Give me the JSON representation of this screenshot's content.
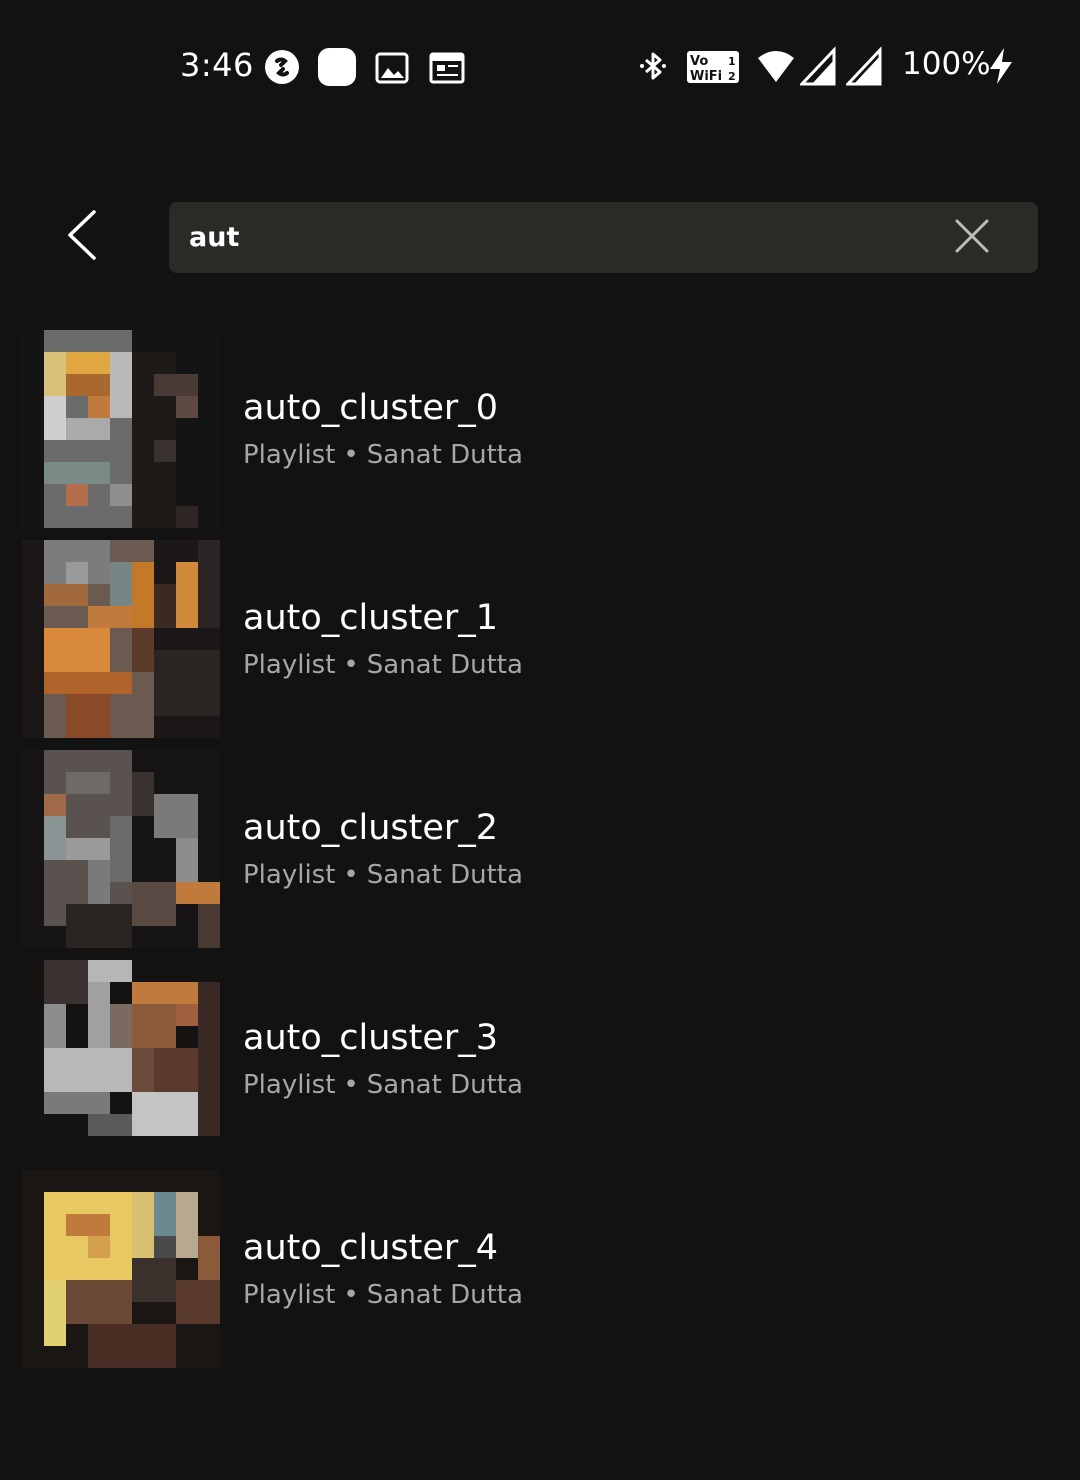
{
  "status_bar": {
    "time": "3:46",
    "battery": "100%",
    "icons_left": [
      "shazam-icon",
      "app-notification-icon",
      "image-icon",
      "calendar-icon"
    ],
    "icons_right": [
      "bluetooth-icon",
      "vowifi-icon",
      "wifi-icon",
      "signal-icon",
      "signal-icon",
      "charging-icon"
    ],
    "vowifi_line1": "Vo",
    "vowifi_line2": "WiFi",
    "vowifi_sim1": "1",
    "vowifi_sim2": "2"
  },
  "search": {
    "query": "aut",
    "back_icon": "chevron-left-icon",
    "clear_icon": "close-icon"
  },
  "results": [
    {
      "title": "auto_cluster_0",
      "type": "Playlist",
      "separator": "•",
      "owner": "Sanat Dutta"
    },
    {
      "title": "auto_cluster_1",
      "type": "Playlist",
      "separator": "•",
      "owner": "Sanat Dutta"
    },
    {
      "title": "auto_cluster_2",
      "type": "Playlist",
      "separator": "•",
      "owner": "Sanat Dutta"
    },
    {
      "title": "auto_cluster_3",
      "type": "Playlist",
      "separator": "•",
      "owner": "Sanat Dutta"
    },
    {
      "title": "auto_cluster_4",
      "type": "Playlist",
      "separator": "•",
      "owner": "Sanat Dutta"
    }
  ],
  "colors": {
    "background": "#121212",
    "search_field": "#2c2a27",
    "primary_text": "#ffffff",
    "secondary_text": "#a7a7a7"
  }
}
